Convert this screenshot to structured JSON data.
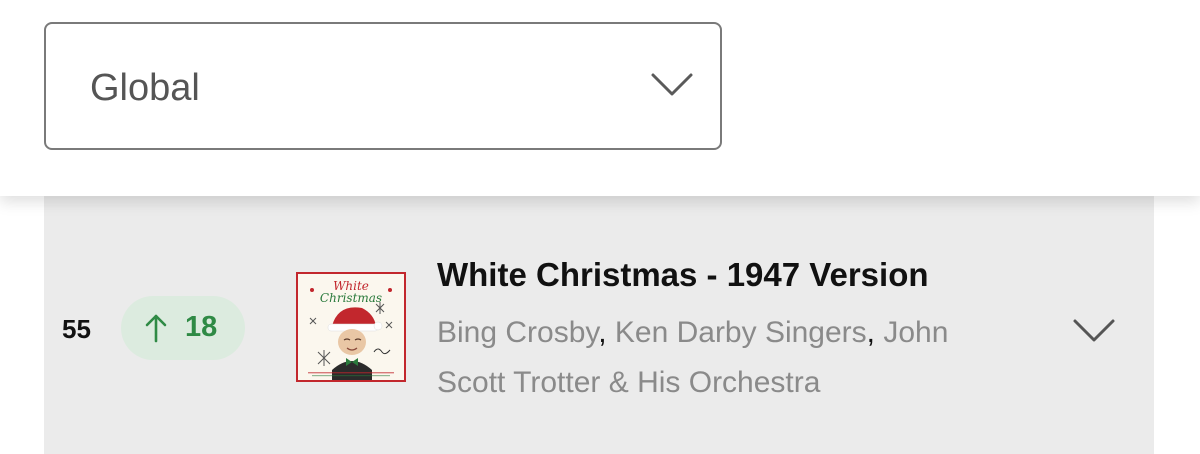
{
  "region_selector": {
    "selected": "Global",
    "icon": "chevron-down-icon"
  },
  "chart_entry": {
    "rank": "55",
    "movement": {
      "direction": "up",
      "value": "18",
      "color": "#2f8a45",
      "icon": "arrow-up-icon"
    },
    "album_cover": {
      "title_line1": "White",
      "title_line2": "Christmas",
      "border_color": "#c2272d"
    },
    "title": "White Christmas - 1947 Version",
    "artists": [
      "Bing Crosby",
      "Ken Darby Singers",
      "John Scott Trotter & His Orchestra"
    ],
    "artist_separator": ",",
    "expand_icon": "chevron-down-icon"
  },
  "colors": {
    "row_background": "#ebebeb",
    "pill_background": "#dcebdf",
    "artist_text": "#8a8a8a"
  }
}
